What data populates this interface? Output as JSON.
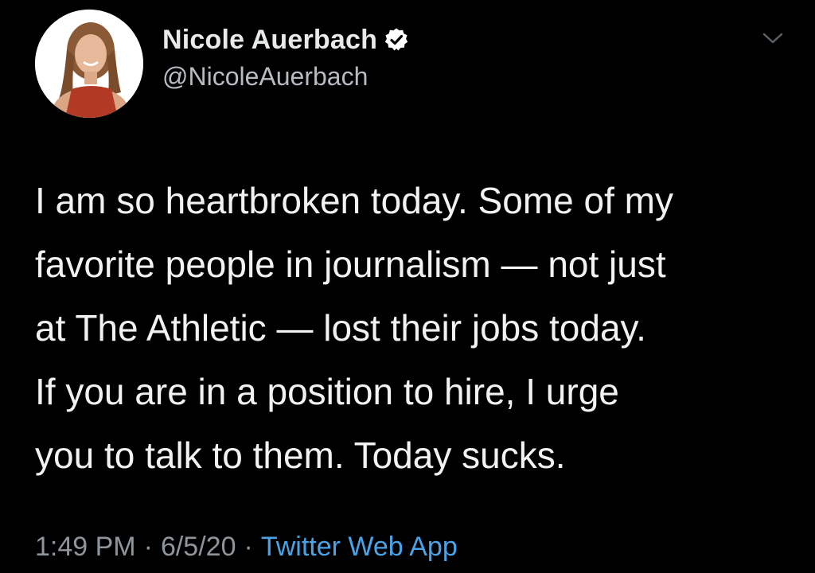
{
  "author": {
    "display_name": "Nicole Auerbach",
    "handle": "@NicoleAuerbach",
    "verified": true
  },
  "tweet": {
    "text": "I am so heartbroken today. Some of my\nfavorite people in journalism — not just\nat The Athletic — lost their jobs today.\nIf you are in a position to hire, I urge\nyou to talk to them. Today sucks.",
    "time": "1:49 PM",
    "date": "6/5/20",
    "separator": "·",
    "source": "Twitter Web App"
  },
  "icons": {
    "verified": "verified-badge-icon",
    "menu": "chevron-down-icon"
  },
  "colors": {
    "background": "#000000",
    "text": "#f2f2f2",
    "secondary": "#8e959b",
    "link": "#4aa3e6"
  }
}
